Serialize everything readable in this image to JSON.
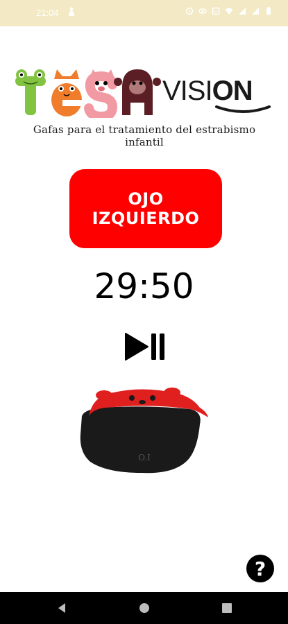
{
  "status_bar": {
    "time": "21:04",
    "icons": [
      "person-icon",
      "alarm-icon",
      "eye-icon",
      "nfc-icon",
      "wifi-icon",
      "signal-icon",
      "signal-icon-2",
      "battery-icon"
    ]
  },
  "logo": {
    "wordmark": "TESA",
    "brand": "VISION",
    "tagline": "Gafas para el tratamiento del estrabismo infantil"
  },
  "main": {
    "eye_button_label": "OJO IZQUIERDO",
    "timer": "29:50",
    "play_pause_icon": "play-pause-icon"
  },
  "glasses": {
    "lens_text": "O.I"
  },
  "help": {
    "label": "?"
  },
  "colors": {
    "status_bar": "#f3e9c4",
    "accent_red": "#ff0000",
    "nav_bar": "#000000"
  }
}
